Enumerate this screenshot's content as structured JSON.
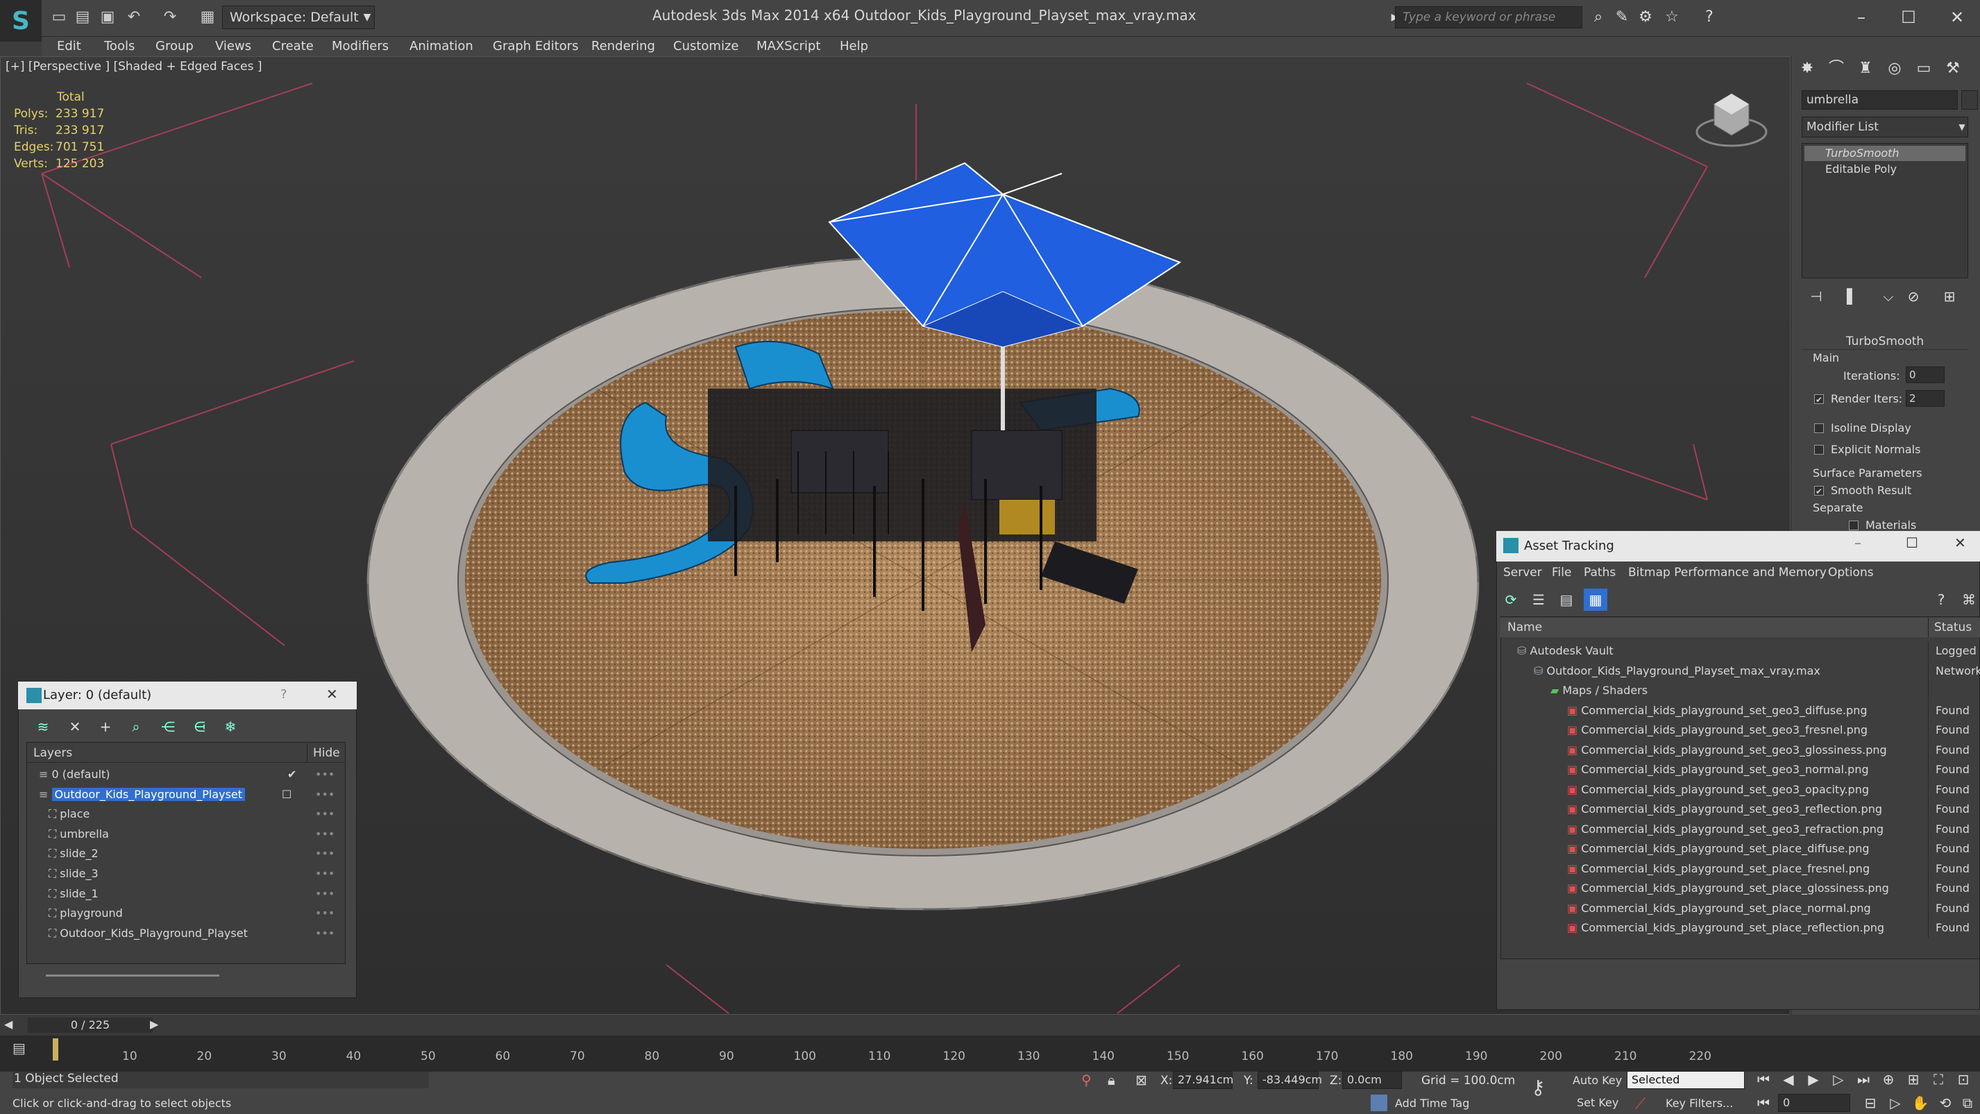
{
  "window": {
    "app_title": "Autodesk 3ds Max  2014 x64      Outdoor_Kids_Playground_Playset_max_vray.max",
    "workspace": "Workspace: Default",
    "search_placeholder": "Type a keyword or phrase"
  },
  "menu": [
    "Edit",
    "Tools",
    "Group",
    "Views",
    "Create",
    "Modifiers",
    "Animation",
    "Graph Editors",
    "Rendering",
    "Customize",
    "MAXScript",
    "Help"
  ],
  "viewport": {
    "label": "[+] [Perspective ] [Shaded + Edged Faces ]",
    "stats": {
      "header": "Total",
      "rows": [
        {
          "k": "Polys:",
          "v": "233 917"
        },
        {
          "k": "Tris:",
          "v": "233 917"
        },
        {
          "k": "Edges:",
          "v": "701 751"
        },
        {
          "k": "Verts:",
          "v": "125 203"
        }
      ]
    }
  },
  "command_panel": {
    "object_name": "umbrella",
    "modifier_list": "Modifier List",
    "stack": [
      "TurboSmooth",
      "Editable Poly"
    ],
    "rollout_title": "TurboSmooth",
    "main": "Main",
    "iterations_label": "Iterations:",
    "iterations_value": "0",
    "render_iters_label": "Render Iters:",
    "render_iters_value": "2",
    "isoline": "Isoline Display",
    "explicit_normals": "Explicit Normals",
    "surface_params": "Surface Parameters",
    "smooth_result": "Smooth Result",
    "separate": "Separate",
    "materials": "Materials"
  },
  "layer_panel": {
    "title": "Layer: 0 (default)",
    "help": "?",
    "col_layers": "Layers",
    "col_hide": "Hide",
    "rows": [
      {
        "name": "0 (default)",
        "indent": 0
      },
      {
        "name": "Outdoor_Kids_Playground_Playset",
        "indent": 0
      },
      {
        "name": "place",
        "indent": 1
      },
      {
        "name": "umbrella",
        "indent": 1
      },
      {
        "name": "slide_2",
        "indent": 1
      },
      {
        "name": "slide_3",
        "indent": 1
      },
      {
        "name": "slide_1",
        "indent": 1
      },
      {
        "name": "playground",
        "indent": 1
      },
      {
        "name": "Outdoor_Kids_Playground_Playset",
        "indent": 1
      }
    ]
  },
  "asset_tracking": {
    "title": "Asset Tracking",
    "menu": [
      "Server",
      "File",
      "Paths",
      "Bitmap Performance and Memory",
      "Options"
    ],
    "col_name": "Name",
    "col_status": "Status",
    "rows": [
      {
        "name": "Autodesk Vault",
        "status": "Logged O",
        "indent": 1
      },
      {
        "name": "Outdoor_Kids_Playground_Playset_max_vray.max",
        "status": "Network",
        "indent": 2
      },
      {
        "name": "Maps / Shaders",
        "status": "",
        "indent": 3
      },
      {
        "name": "Commercial_kids_playground_set_geo3_diffuse.png",
        "status": "Found",
        "indent": 4
      },
      {
        "name": "Commercial_kids_playground_set_geo3_fresnel.png",
        "status": "Found",
        "indent": 4
      },
      {
        "name": "Commercial_kids_playground_set_geo3_glossiness.png",
        "status": "Found",
        "indent": 4
      },
      {
        "name": "Commercial_kids_playground_set_geo3_normal.png",
        "status": "Found",
        "indent": 4
      },
      {
        "name": "Commercial_kids_playground_set_geo3_opacity.png",
        "status": "Found",
        "indent": 4
      },
      {
        "name": "Commercial_kids_playground_set_geo3_reflection.png",
        "status": "Found",
        "indent": 4
      },
      {
        "name": "Commercial_kids_playground_set_geo3_refraction.png",
        "status": "Found",
        "indent": 4
      },
      {
        "name": "Commercial_kids_playground_set_place_diffuse.png",
        "status": "Found",
        "indent": 4
      },
      {
        "name": "Commercial_kids_playground_set_place_fresnel.png",
        "status": "Found",
        "indent": 4
      },
      {
        "name": "Commercial_kids_playground_set_place_glossiness.png",
        "status": "Found",
        "indent": 4
      },
      {
        "name": "Commercial_kids_playground_set_place_normal.png",
        "status": "Found",
        "indent": 4
      },
      {
        "name": "Commercial_kids_playground_set_place_reflection.png",
        "status": "Found",
        "indent": 4
      }
    ]
  },
  "timeline": {
    "frame": "0 / 225",
    "ticks": [
      "10",
      "20",
      "30",
      "40",
      "50",
      "60",
      "70",
      "80",
      "90",
      "100",
      "110",
      "120",
      "130",
      "140",
      "150",
      "160",
      "170",
      "180",
      "190",
      "200",
      "210",
      "220"
    ]
  },
  "status": {
    "selected": "1 Object Selected",
    "prompt": "Click or click-and-drag to select objects",
    "x_label": "X:",
    "x_value": "27.941cm",
    "y_label": "Y:",
    "y_value": "-83.449cm",
    "z_label": "Z:",
    "z_value": "0.0cm",
    "grid": "Grid = 100.0cm",
    "auto_key": "Auto Key",
    "set_key": "Set Key",
    "selected_dd": "Selected",
    "key_filters": "Key Filters...",
    "add_time_tag": "Add Time Tag",
    "frame_field": "0"
  },
  "colors": {
    "accent": "#2f6fd1",
    "stats_text": "#e6d26a",
    "umbrella": "#1f5fe0",
    "slide": "#1a8fd0"
  }
}
